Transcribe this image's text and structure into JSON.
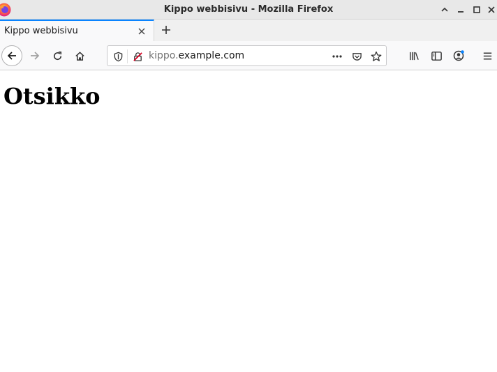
{
  "window": {
    "title": "Kippo webbisivu - Mozilla Firefox",
    "app_icon": "firefox-icon",
    "controls": [
      "chevron-up-icon",
      "minimize-icon",
      "maximize-icon",
      "close-icon"
    ]
  },
  "tabs": [
    {
      "label": "Kippo webbisivu",
      "active": true
    }
  ],
  "navbar": {
    "url_subdomain": "kippo.",
    "url_domain": "example.com",
    "icons": [
      "back-icon",
      "forward-icon",
      "reload-icon",
      "home-icon",
      "shield-icon",
      "insecure-connection-icon",
      "more-dots-icon",
      "pocket-icon",
      "star-icon",
      "library-icon",
      "sidebar-icon",
      "account-icon",
      "menu-icon"
    ]
  },
  "page": {
    "heading": "Otsikko"
  },
  "colors": {
    "accent": "#0a84ff",
    "toolbar": "#f9f9fa",
    "titlebar": "#e8e8e8",
    "insecure": "#d70022"
  }
}
